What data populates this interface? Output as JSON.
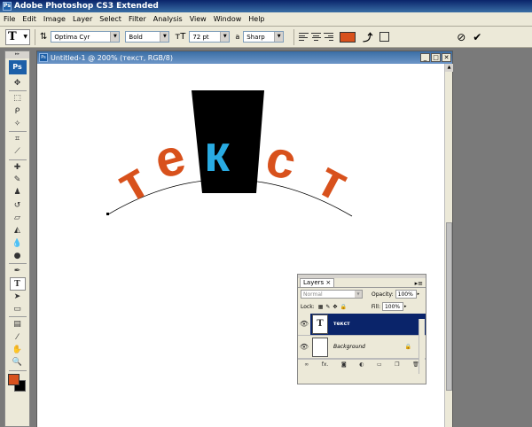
{
  "app": {
    "title": "Adobe Photoshop CS3 Extended",
    "logo": "Ps"
  },
  "menu": [
    "File",
    "Edit",
    "Image",
    "Layer",
    "Select",
    "Filter",
    "Analysis",
    "View",
    "Window",
    "Help"
  ],
  "options": {
    "tool_preset": "T",
    "font_family": "Optima Cyr",
    "font_style": "Bold",
    "font_size": "72 pt",
    "antialias_label": "a",
    "antialias": "Sharp",
    "text_color": "#d8511c"
  },
  "toolbox": {
    "badge": "Ps",
    "tools": [
      "move",
      "marquee",
      "lasso",
      "magic-wand",
      "crop",
      "slice",
      "healing",
      "brush",
      "stamp",
      "history-brush",
      "eraser",
      "bucket",
      "blur",
      "dodge",
      "pen",
      "type",
      "path-select",
      "shape",
      "notes",
      "eyedropper",
      "hand",
      "zoom"
    ],
    "active_tool_glyph": "T",
    "foreground_color": "#d8511c",
    "background_color": "#000000"
  },
  "document": {
    "title": "Untitled-1 @ 200% (текст, RGB/8)",
    "canvas_text": {
      "letters": [
        "т",
        "е",
        "к",
        "с",
        "т"
      ],
      "text_color": "#d8511c",
      "highlight_color": "#29abe2"
    }
  },
  "layers_panel": {
    "tab": "Layers",
    "blend_mode": "Normal",
    "opacity_label": "Opacity:",
    "opacity": "100%",
    "lock_label": "Lock:",
    "fill_label": "Fill:",
    "fill": "100%",
    "layers": [
      {
        "name": "текст",
        "selected": true,
        "thumb": "T"
      },
      {
        "name": "Background",
        "selected": false,
        "locked": true
      }
    ],
    "footer_icons": [
      "link-icon",
      "fx-icon",
      "mask-icon",
      "adjustment-icon",
      "folder-icon",
      "new-layer-icon",
      "trash-icon"
    ]
  }
}
